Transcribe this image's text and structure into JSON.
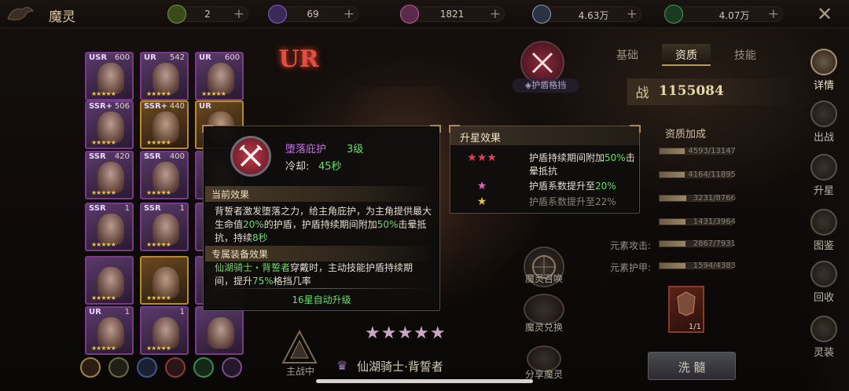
{
  "header": {
    "title": "魔灵",
    "resources": [
      {
        "icon": "leaf-coin-icon",
        "value": "2",
        "color": "#6f9a3a"
      },
      {
        "icon": "purple-gem-icon",
        "value": "69",
        "color": "#8a5cc8"
      },
      {
        "icon": "pink-gem-icon",
        "value": "1821",
        "color": "#c85c9a"
      },
      {
        "icon": "diamond-icon",
        "value": "4.63万",
        "color": "#8aa0b8"
      },
      {
        "icon": "green-bars-icon",
        "value": "4.07万",
        "color": "#3aa05a"
      }
    ]
  },
  "cards": [
    {
      "rarity": "USR",
      "num": "600",
      "stars": "★★★★★"
    },
    {
      "rarity": "UR",
      "num": "542",
      "stars": "★★★★★"
    },
    {
      "rarity": "UR",
      "num": "600",
      "stars": "★★★★★"
    },
    {
      "rarity": "SSR+",
      "num": "506",
      "stars": "★★★★★"
    },
    {
      "rarity": "SSR+",
      "num": "440",
      "stars": "★★★★★"
    },
    {
      "rarity": "UR",
      "num": "",
      "stars": ""
    },
    {
      "rarity": "SSR",
      "num": "420",
      "stars": "★★★★★"
    },
    {
      "rarity": "SSR",
      "num": "400",
      "stars": "★★★★★"
    },
    {
      "rarity": "",
      "num": "",
      "stars": ""
    },
    {
      "rarity": "SSR",
      "num": "1",
      "stars": "★★★★★"
    },
    {
      "rarity": "SSR",
      "num": "1",
      "stars": "★★★★★"
    },
    {
      "rarity": "",
      "num": "",
      "stars": ""
    },
    {
      "rarity": "",
      "num": "",
      "stars": "★★★★★"
    },
    {
      "rarity": "",
      "num": "",
      "stars": "★★★★★"
    },
    {
      "rarity": "",
      "num": "",
      "stars": ""
    },
    {
      "rarity": "UR",
      "num": "1",
      "stars": "★★★★★"
    },
    {
      "rarity": "",
      "num": "1",
      "stars": "★★★★★"
    },
    {
      "rarity": "",
      "num": "",
      "stars": ""
    }
  ],
  "grade_badge": "UR",
  "skill_badge_label": "护盾格挡",
  "tabs": [
    "基础",
    "资质",
    "技能"
  ],
  "active_tab": "资质",
  "power": {
    "label": "战",
    "value": "1155084"
  },
  "aptitude": {
    "title": "资质加成",
    "rows": [
      {
        "label": "",
        "value": "4593/13147",
        "fraction": 0.35
      },
      {
        "label": "",
        "value": "4164/11895",
        "fraction": 0.35
      },
      {
        "label": "",
        "value": "3231/8766",
        "fraction": 0.37
      },
      {
        "label": "",
        "value": "1431/3964",
        "fraction": 0.36
      },
      {
        "label": "元素攻击:",
        "value": "2867/7931",
        "fraction": 0.36
      },
      {
        "label": "元素护甲:",
        "value": "1594/4383",
        "fraction": 0.36
      }
    ]
  },
  "skill_popup": {
    "name": "堕落庇护",
    "level": "3级",
    "cooldown_label": "冷却:",
    "cooldown_value": "45秒",
    "current_effect_title": "当前效果",
    "current_effect_parts": [
      {
        "t": "背誓者激发堕落之力，给主角庇护，为主角提供最大生命值",
        "c": ""
      },
      {
        "t": "20%",
        "c": "hl"
      },
      {
        "t": "的护盾，护盾持续期间附加",
        "c": ""
      },
      {
        "t": "50%",
        "c": "hl"
      },
      {
        "t": "击晕抵抗，持续",
        "c": ""
      },
      {
        "t": "8秒",
        "c": "hl"
      }
    ],
    "exclusive_title": "专属装备效果",
    "exclusive_parts": [
      {
        "t": "仙湖骑士・背誓者",
        "c": "hl"
      },
      {
        "t": "穿戴时，主动技能护盾持续期间，提升",
        "c": ""
      },
      {
        "t": "75%",
        "c": "hl"
      },
      {
        "t": "格挡几率",
        "c": ""
      }
    ],
    "footer": "16星自动升级"
  },
  "star_popup": {
    "title": "升星效果",
    "rows": [
      {
        "stars": "★★★",
        "star_color": "#e04050",
        "parts": [
          {
            "t": "护盾持续期间附加",
            "c": ""
          },
          {
            "t": "50%",
            "c": "hl"
          },
          {
            "t": "击晕抵抗",
            "c": ""
          }
        ],
        "dim": false
      },
      {
        "stars": "★",
        "star_color": "#e060c0",
        "parts": [
          {
            "t": "护盾系数提升至",
            "c": ""
          },
          {
            "t": "20%",
            "c": "hl"
          }
        ],
        "dim": false
      },
      {
        "stars": "★",
        "star_color": "#e8c040",
        "parts": [
          {
            "t": "护盾系数提升至22%",
            "c": ""
          }
        ],
        "dim": true
      }
    ]
  },
  "right_nav": [
    "详情",
    "出战",
    "升星",
    "图鉴",
    "回收",
    "灵装"
  ],
  "center_buttons": [
    "魔灵召唤",
    "魔灵兑换",
    "分享魔灵"
  ],
  "bottom": {
    "deploy_label": "主战中",
    "hero_stars": "★★★★★",
    "hero_name": "仙湖骑士·背誓者",
    "wash_button": "洗 髓",
    "item_count": "1/1"
  }
}
